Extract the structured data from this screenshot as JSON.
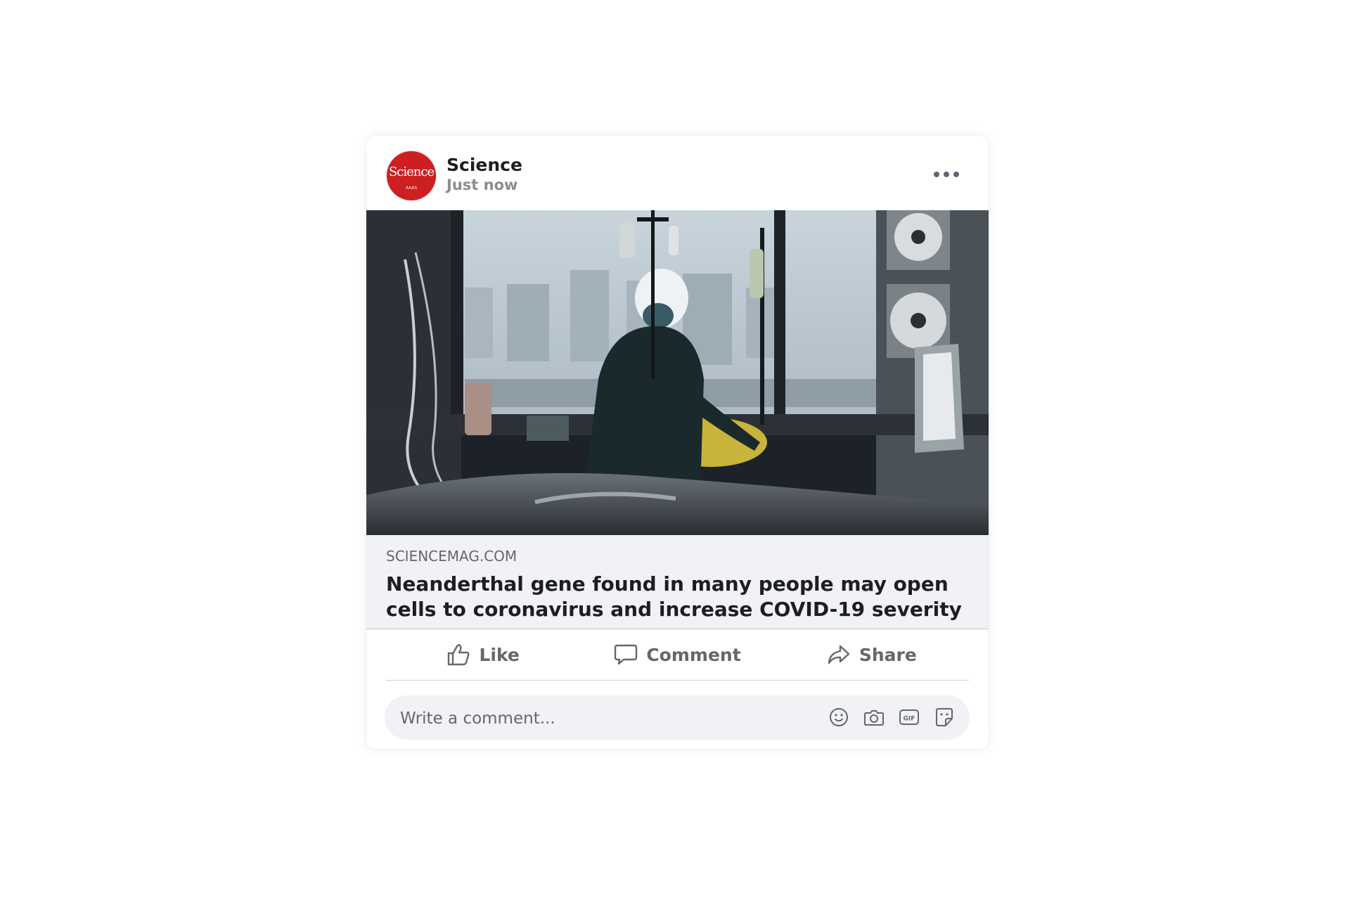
{
  "post": {
    "page_name": "Science",
    "time": "Just now",
    "avatar": {
      "word": "Science",
      "subline": "AAAS",
      "bg_color": "#cc1f22"
    },
    "image": {
      "subject": "hospital-icu-scene"
    },
    "link": {
      "domain": "SCIENCEMAG.COM",
      "title": "Neanderthal gene found in many people may open cells to coronavirus and increase COVID-19 severity"
    },
    "actions": {
      "like": "Like",
      "comment": "Comment",
      "share": "Share"
    },
    "comment_box": {
      "placeholder": "Write a comment...",
      "icons": [
        "emoji-icon",
        "camera-icon",
        "gif-icon",
        "sticker-icon"
      ]
    }
  },
  "colors": {
    "text_primary": "#1c1e21",
    "text_secondary": "#65676b",
    "muted": "#8a8d91",
    "preview_bg": "#f0f2f5",
    "brand_red": "#cc1f22"
  }
}
